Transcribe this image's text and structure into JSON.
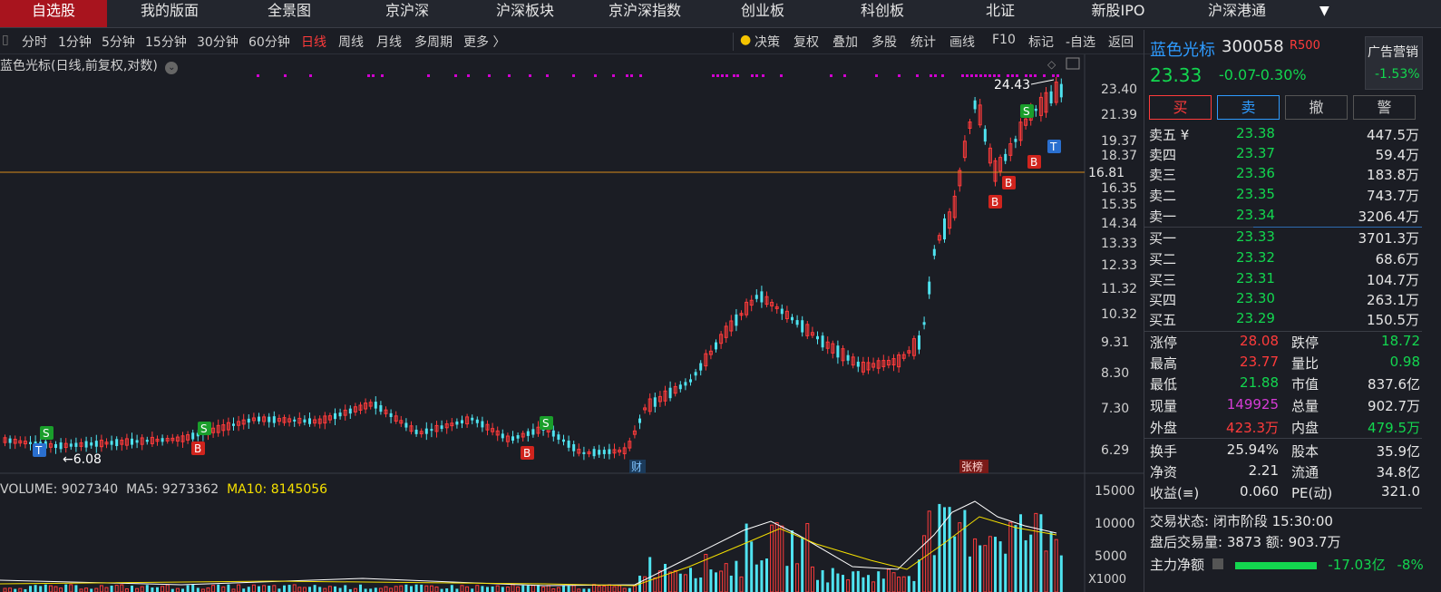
{
  "nav": {
    "tabs": [
      "自选股",
      "我的版面",
      "全景图",
      "京沪深",
      "沪深板块",
      "京沪深指数",
      "创业板",
      "科创板",
      "北证",
      "新股IPO",
      "沪深港通"
    ],
    "dropdown_icon": "▼"
  },
  "toolbar": {
    "periods": [
      "分时",
      "1分钟",
      "5分钟",
      "15分钟",
      "30分钟",
      "60分钟",
      "日线",
      "周线",
      "月线",
      "多周期",
      "更多 〉"
    ],
    "tools": [
      "决策",
      "复权",
      "叠加",
      "多股",
      "统计",
      "画线",
      "F10",
      "标记",
      "-自选",
      "返回"
    ]
  },
  "chart": {
    "title": "蓝色光标(日线,前复权,对数)",
    "y_ticks": [
      "23.40",
      "21.39",
      "19.37",
      "18.37",
      "16.35",
      "15.35",
      "14.34",
      "13.33",
      "12.33",
      "11.32",
      "10.32",
      "9.31",
      "8.30",
      "7.30",
      "6.29"
    ],
    "current_line_label": "16.81",
    "high_label": "24.43",
    "low_label": "←6.08",
    "cai_marker": "财",
    "zhangbang_marker": "张榜",
    "signal_labels": {
      "s": "S",
      "b": "B",
      "t": "T"
    }
  },
  "volume": {
    "title": "VOLUME: 9027340",
    "ma5": "MA5: 9273362",
    "ma10": "MA10: 8145056",
    "y_ticks": [
      "15000",
      "10000",
      "5000"
    ],
    "unit": "X1000"
  },
  "quote": {
    "name": "蓝色光标",
    "code": "300058",
    "badge": "R500",
    "price": "23.33",
    "change": "-0.07",
    "change_pct": "-0.30%",
    "ad_title": "广告营销",
    "ad_value": "-1.53%",
    "buttons": {
      "buy": "买",
      "sell": "卖",
      "cancel": "撤",
      "warn": "警"
    },
    "asks": [
      {
        "label": "卖五 ¥",
        "price": "23.38",
        "vol": "447.5万"
      },
      {
        "label": "卖四",
        "price": "23.37",
        "vol": "59.4万"
      },
      {
        "label": "卖三",
        "price": "23.36",
        "vol": "183.8万"
      },
      {
        "label": "卖二",
        "price": "23.35",
        "vol": "743.7万"
      },
      {
        "label": "卖一",
        "price": "23.34",
        "vol": "3206.4万"
      }
    ],
    "bids": [
      {
        "label": "买一",
        "price": "23.33",
        "vol": "3701.3万"
      },
      {
        "label": "买二",
        "price": "23.32",
        "vol": "68.6万"
      },
      {
        "label": "买三",
        "price": "23.31",
        "vol": "104.7万"
      },
      {
        "label": "买四",
        "price": "23.30",
        "vol": "263.1万"
      },
      {
        "label": "买五",
        "price": "23.29",
        "vol": "150.5万"
      }
    ],
    "stats_left": [
      {
        "label": "涨停",
        "value": "28.08",
        "color": "#ff3b3b"
      },
      {
        "label": "最高",
        "value": "23.77",
        "color": "#ff3b3b"
      },
      {
        "label": "最低",
        "value": "21.88",
        "color": "#13d64f"
      },
      {
        "label": "现量",
        "value": "149925",
        "color": "#d63bd6"
      },
      {
        "label": "外盘",
        "value": "423.3万",
        "color": "#ff3b3b"
      }
    ],
    "stats_right": [
      {
        "label": "跌停",
        "value": "18.72",
        "color": "#13d64f"
      },
      {
        "label": "量比",
        "value": "0.98",
        "color": "#13d64f"
      },
      {
        "label": "市值",
        "value": "837.6亿",
        "color": "#e6e6e6"
      },
      {
        "label": "总量",
        "value": "902.7万",
        "color": "#e6e6e6"
      },
      {
        "label": "内盘",
        "value": "479.5万",
        "color": "#13d64f"
      }
    ],
    "fund_left": [
      {
        "label": "换手",
        "value": "25.94%"
      },
      {
        "label": "净资",
        "value": "2.21"
      },
      {
        "label": "收益(≡)",
        "value": "0.060"
      }
    ],
    "fund_right": [
      {
        "label": "股本",
        "value": "35.9亿"
      },
      {
        "label": "流通",
        "value": "34.8亿"
      },
      {
        "label": "PE(动)",
        "value": "321.0"
      }
    ],
    "trade_status": "交易状态: 闭市阶段 15:30:00",
    "after_hours": "盘后交易量: 3873  额: 903.7万",
    "main_flow_label": "主力净额",
    "main_flow_value": "-17.03亿",
    "main_flow_pct": "-8%"
  },
  "colors": {
    "up": "#ff3b3b",
    "down": "#4fe3f0",
    "green": "#13d64f",
    "accent": "#2e9bff",
    "ma5": "#ffffff",
    "ma10": "#f5e000",
    "hline": "#d88a1a",
    "marker": "#d000d0"
  }
}
